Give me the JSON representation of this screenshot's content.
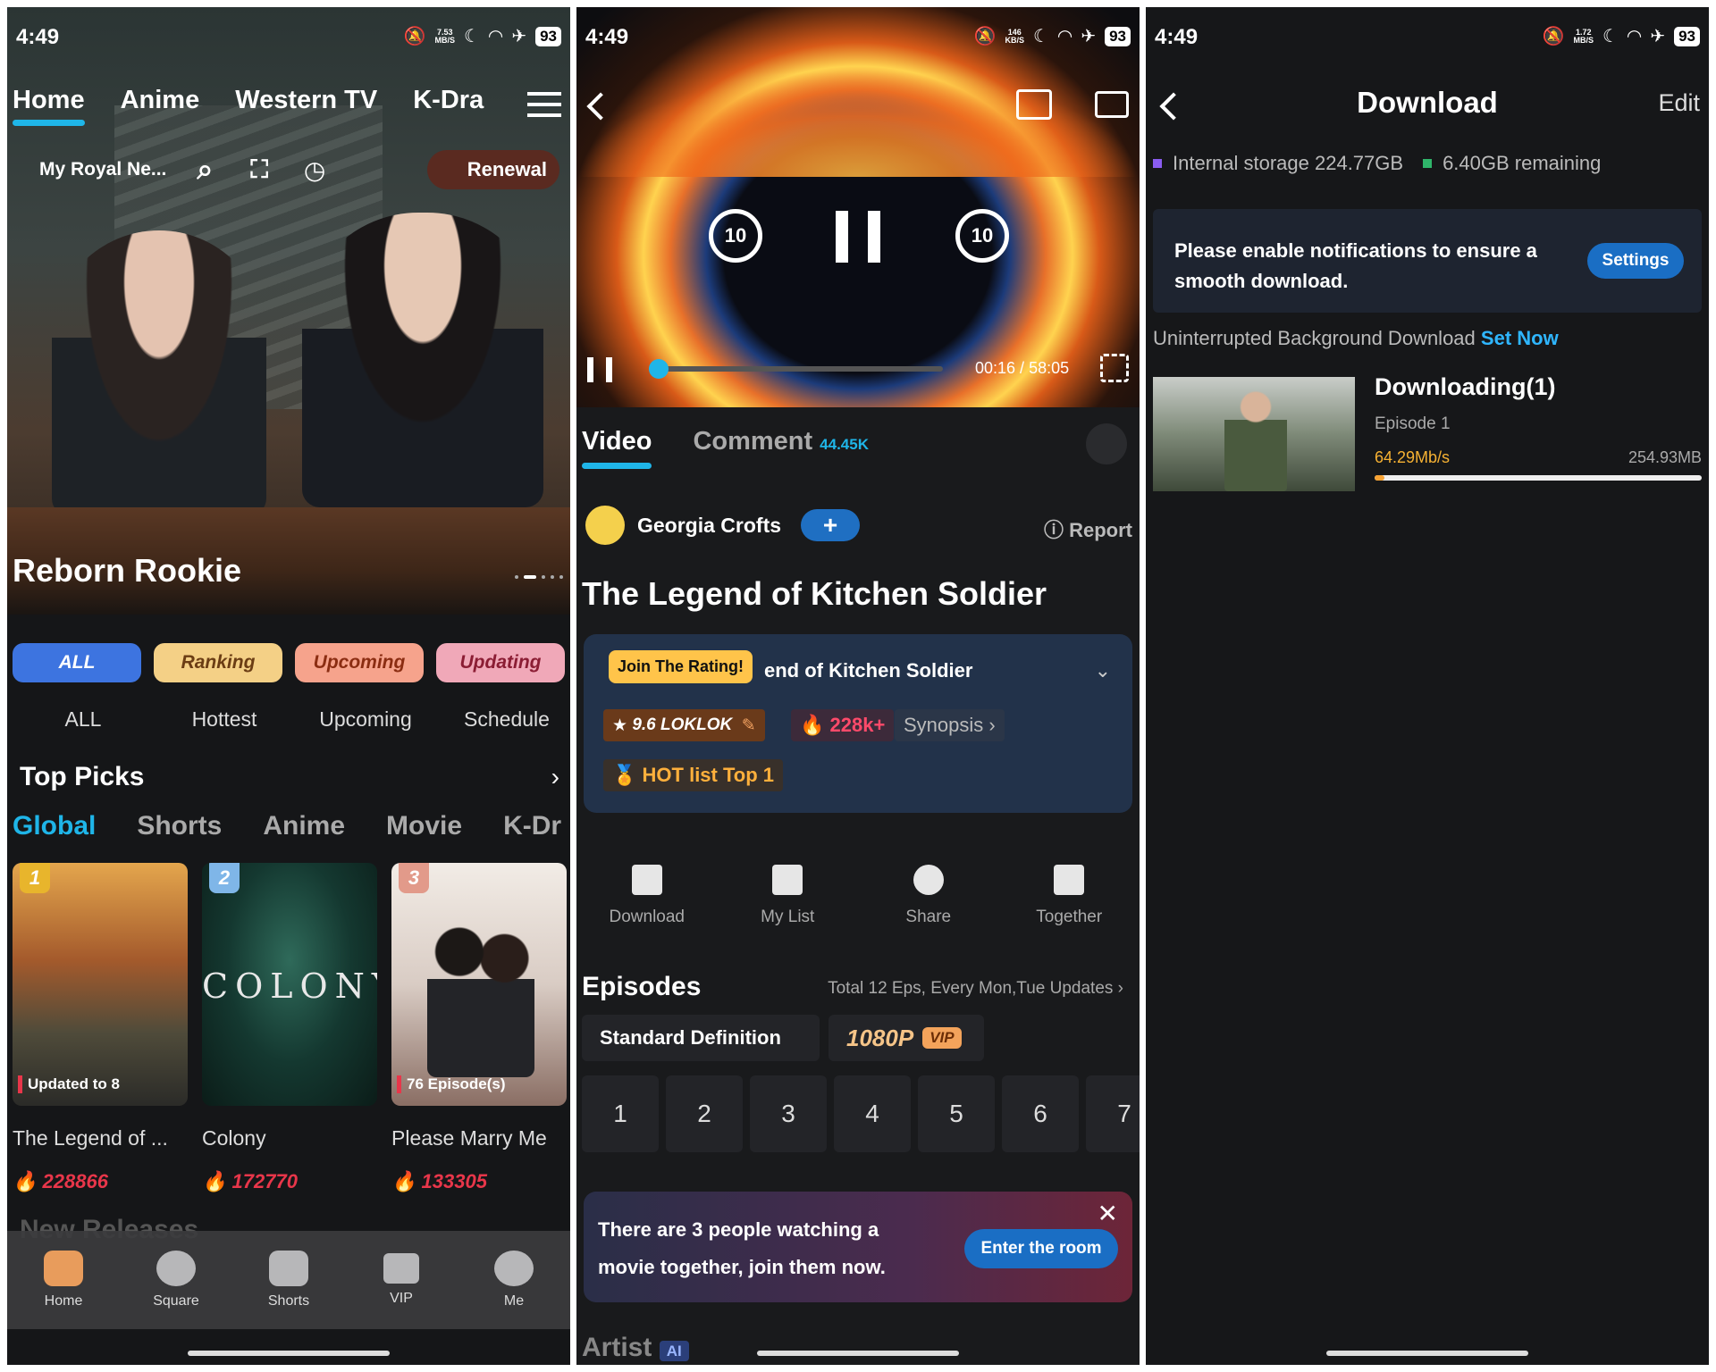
{
  "status": {
    "time": "4:49",
    "battery": "93",
    "speed1": "7.53\nMB/S",
    "speed2": "146\nKB/S",
    "speed3": "1.72\nMB/S"
  },
  "home": {
    "tabs": [
      "Home",
      "Anime",
      "Western TV",
      "K-Dra"
    ],
    "account": "My Royal Ne...",
    "renewal": "Renewal",
    "hero_title": "Reborn Rookie",
    "categories": [
      {
        "chip": "ALL",
        "label": "ALL",
        "color": "#3d74e0"
      },
      {
        "chip": "Ranking",
        "label": "Hottest",
        "color": "#f4d086"
      },
      {
        "chip": "Upcoming",
        "label": "Upcoming",
        "color": "#f6a38c"
      },
      {
        "chip": "Updating",
        "label": "Schedule",
        "color": "#f0a8b8"
      }
    ],
    "section_title": "Top Picks",
    "subtabs": [
      "Global",
      "Shorts",
      "Anime",
      "Movie",
      "K-Dr"
    ],
    "cards": [
      {
        "rank": "1",
        "tag": "Updated to 8",
        "title": "The Legend of ...",
        "heat": "228866"
      },
      {
        "rank": "2",
        "tag": "",
        "art": "COLONY",
        "title": "Colony",
        "heat": "172770"
      },
      {
        "rank": "3",
        "tag": "76 Episode(s)",
        "title": "Please Marry Me",
        "heat": "133305"
      }
    ],
    "bottom_nav": [
      "Home",
      "Square",
      "Shorts",
      "VIP",
      "Me"
    ],
    "partial_section": "New Releases"
  },
  "player": {
    "skip_back": "10",
    "skip_fwd": "10",
    "time_current": "00:16",
    "time_total": "58:05",
    "progress": 0.005,
    "tab_video": "Video",
    "tab_comment": "Comment",
    "comment_count": "44.45K",
    "uploader": "Georgia Crofts",
    "follow": "+",
    "report": "Report",
    "title": "The Legend of Kitchen Soldier",
    "rating_bubble": "Join The Rating!",
    "info_title": "end of Kitchen Soldier",
    "score": "9.6 LOKLOK",
    "heat": "228k+",
    "synopsis": "Synopsis",
    "hot": "HOT list Top 1",
    "actions": [
      "Download",
      "My List",
      "Share",
      "Together"
    ],
    "episodes_title": "Episodes",
    "episodes_meta": "Total 12 Eps, Every Mon,Tue Updates",
    "def_standard": "Standard Definition",
    "def_hd": "1080P",
    "vip": "VIP",
    "episodes": [
      "1",
      "2",
      "3",
      "4",
      "5",
      "6",
      "7"
    ],
    "banner_text": "There are 3 people watching a movie together, join them now.",
    "banner_btn": "Enter the room",
    "artist": "Artist",
    "ai": "AI"
  },
  "download": {
    "title": "Download",
    "edit": "Edit",
    "storage_internal": "Internal storage 224.77GB",
    "storage_remaining": "6.40GB remaining",
    "notice": "Please enable notifications to ensure a smooth download.",
    "settings": "Settings",
    "background": "Uninterrupted Background Download",
    "set_now": "Set Now",
    "item_title": "Downloading(1)",
    "episode": "Episode 1",
    "speed": "64.29Mb/s",
    "size": "254.93MB",
    "progress": 0.03
  }
}
